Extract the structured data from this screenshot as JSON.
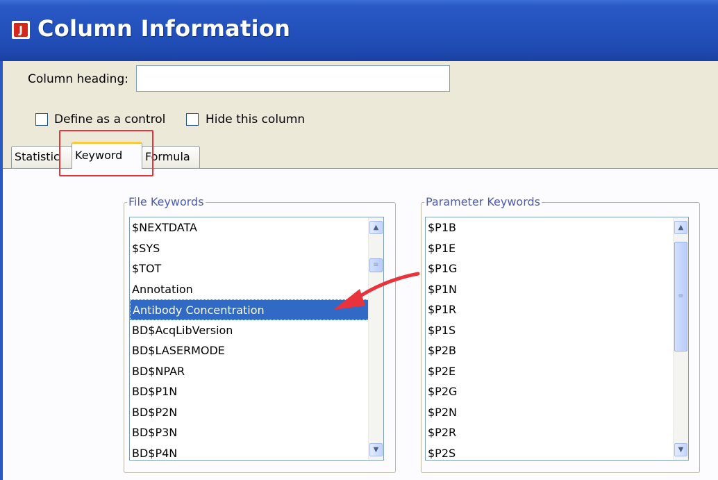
{
  "window": {
    "title": "Column Information",
    "app_icon_letter": "J"
  },
  "form": {
    "column_heading_label": "Column heading:",
    "column_heading_value": "",
    "define_control_label": "Define as a control",
    "hide_column_label": "Hide this column"
  },
  "tabs": [
    {
      "label": "Statistic",
      "active": false
    },
    {
      "label": "Keyword",
      "active": true
    },
    {
      "label": "Formula",
      "active": false
    }
  ],
  "file_keywords": {
    "title": "File Keywords",
    "items": [
      "$NEXTDATA",
      "$SYS",
      "$TOT",
      "Annotation",
      "Antibody Concentration",
      "BD$AcqLibVersion",
      "BD$LASERMODE",
      "BD$NPAR",
      "BD$P1N",
      "BD$P2N",
      "BD$P3N",
      "BD$P4N"
    ],
    "selected": "Antibody Concentration"
  },
  "parameter_keywords": {
    "title": "Parameter Keywords",
    "items": [
      "$P1B",
      "$P1E",
      "$P1G",
      "$P1N",
      "$P1R",
      "$P1S",
      "$P2B",
      "$P2E",
      "$P2G",
      "$P2N",
      "$P2R",
      "$P2S"
    ]
  },
  "icons": {
    "scroll_up": "chevron-up-icon",
    "scroll_down": "chevron-down-icon",
    "thumb_grip": "grip-icon",
    "annotation_arrow": "red-arrow-icon"
  },
  "colors": {
    "title_bar": "#2452bd",
    "selection": "#316ac5",
    "highlight": "#e8323c",
    "active_tab_accent": "#ffc83c"
  }
}
